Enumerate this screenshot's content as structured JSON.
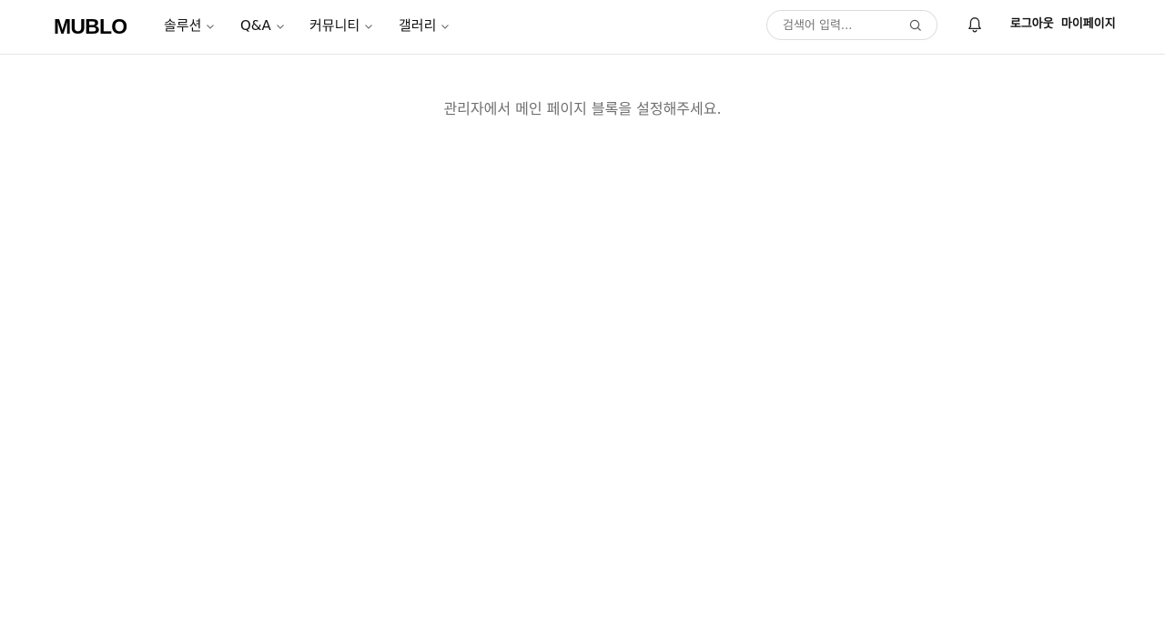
{
  "header": {
    "logo": "MUBLO",
    "nav": [
      {
        "label": "솔루션"
      },
      {
        "label": "Q&A"
      },
      {
        "label": "커뮤니티"
      },
      {
        "label": "갤러리"
      }
    ],
    "search": {
      "placeholder": "검색어 입력...",
      "value": ""
    },
    "logout_label": "로그아웃",
    "mypage_label": "마이페이지"
  },
  "main": {
    "empty_message": "관리자에서 메인 페이지 블록을 설정해주세요."
  },
  "icons": {
    "chevron": "chevron-down-icon",
    "search": "search-icon",
    "notification": "bell-icon"
  },
  "colors": {
    "text": "#111111",
    "muted": "#707070",
    "border": "#e5e5e5",
    "background": "#ffffff"
  }
}
